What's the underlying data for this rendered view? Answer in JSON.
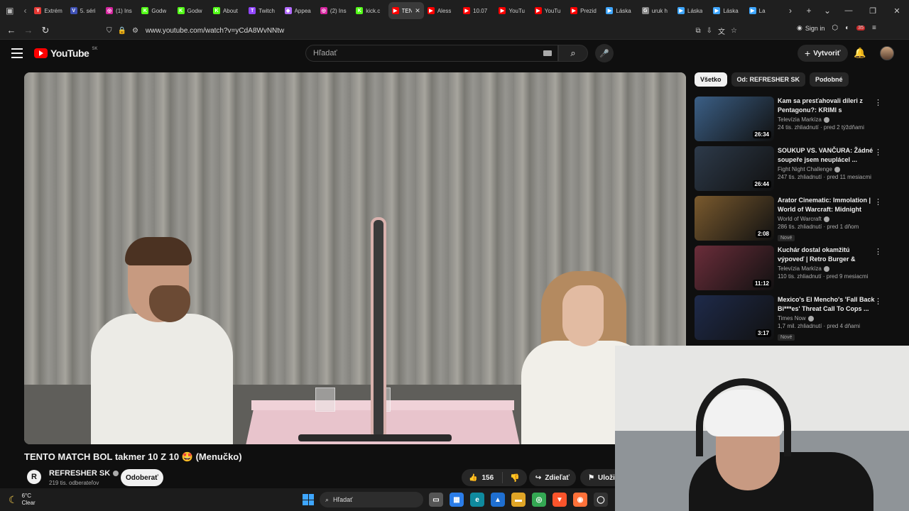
{
  "browser": {
    "tabs": [
      {
        "title": "Extrém",
        "fav": "Y",
        "color": "#e53935"
      },
      {
        "title": "5. séri",
        "fav": "V",
        "color": "#3f51b5"
      },
      {
        "title": "(1) Ins",
        "fav": "◎",
        "color": "#d6249f"
      },
      {
        "title": "Godw",
        "fav": "K",
        "color": "#53fc18"
      },
      {
        "title": "Godw",
        "fav": "K",
        "color": "#53fc18"
      },
      {
        "title": "About",
        "fav": "K",
        "color": "#53fc18"
      },
      {
        "title": "Twitch",
        "fav": "T",
        "color": "#9146ff"
      },
      {
        "title": "Appea",
        "fav": "◆",
        "color": "#b36bff"
      },
      {
        "title": "(2) Ins",
        "fav": "◎",
        "color": "#d6249f"
      },
      {
        "title": "kick.c",
        "fav": "K",
        "color": "#53fc18"
      },
      {
        "title": "TEN",
        "fav": "▶",
        "color": "#ff0000",
        "active": true
      },
      {
        "title": "Aless",
        "fav": "▶",
        "color": "#ff0000"
      },
      {
        "title": "10.07",
        "fav": "▶",
        "color": "#ff0000"
      },
      {
        "title": "YouTu",
        "fav": "▶",
        "color": "#ff0000"
      },
      {
        "title": "YouTu",
        "fav": "▶",
        "color": "#ff0000"
      },
      {
        "title": "Prezid",
        "fav": "▶",
        "color": "#ff0000"
      },
      {
        "title": "Láska",
        "fav": "▶",
        "color": "#3ea6ff"
      },
      {
        "title": "uruk h",
        "fav": "G",
        "color": "#888888"
      },
      {
        "title": "Láska",
        "fav": "▶",
        "color": "#3ea6ff"
      },
      {
        "title": "Láska",
        "fav": "▶",
        "color": "#3ea6ff"
      },
      {
        "title": "La",
        "fav": "▶",
        "color": "#3ea6ff"
      }
    ],
    "url": "www.youtube.com/watch?v=yCdA8WvNNtw",
    "sign_in": "Sign in",
    "notif_count": "35"
  },
  "youtube": {
    "logo": "YouTube",
    "region": "SK",
    "search_placeholder": "Hľadať",
    "create_label": "Vytvoriť"
  },
  "video": {
    "title": "TENTO MATCH BOL takmer 10 Z 10 🤩 (Menučko)",
    "channel": "REFRESHER SK",
    "channel_initial": "R",
    "subscribers": "219 tis. odberateľov",
    "subscribe_label": "Odoberať",
    "likes": "156",
    "share_label": "Zdieľať",
    "save_label": "Uloži"
  },
  "chips": [
    {
      "label": "Všetko",
      "active": true
    },
    {
      "label": "Od: REFRESHER SK",
      "active": false
    },
    {
      "label": "Podobné",
      "active": false
    }
  ],
  "recommendations": [
    {
      "title": "Kam sa presťahovali díleri z Pentagonu?: KRIMI s Kristínou...",
      "channel": "Televízia Markíza",
      "meta": "24 tis. zhliadnutí · pred 2 týždňami",
      "duration": "26:34",
      "thumb": "#3b5f86",
      "badge": ""
    },
    {
      "title": "SOUKUP VS. VANČURA: Žádné soupeře jsem neuplácel ...",
      "channel": "Fight Night Challenge",
      "meta": "247 tis. zhliadnutí · pred 11 mesiacmi",
      "duration": "26:44",
      "thumb": "#2d3a4a",
      "badge": ""
    },
    {
      "title": "Arator Cinematic: Immolation | World of Warcraft: Midnight",
      "channel": "World of Warcraft",
      "meta": "286 tis. zhliadnutí · pred 1 dňom",
      "duration": "2:08",
      "thumb": "#7a5a2e",
      "badge": "Nové"
    },
    {
      "title": "Kuchár dostal okamžitú výpoveď | Retro Burger & Dinn...",
      "channel": "Televízia Markíza",
      "meta": "110 tis. zhliadnutí · pred 9 mesiacmi",
      "duration": "11:12",
      "thumb": "#6b2d3a",
      "badge": ""
    },
    {
      "title": "Mexico's El Mencho's 'Fall Back Bi***es' Threat Call To Cops ...",
      "channel": "Times Now",
      "meta": "1,7 mil. zhliadnutí · pred 4 dňami",
      "duration": "3:17",
      "thumb": "#1e2a4a",
      "badge": "Nové"
    }
  ],
  "taskbar": {
    "temperature": "6°C",
    "condition": "Clear",
    "search_label": "Hľadať"
  }
}
